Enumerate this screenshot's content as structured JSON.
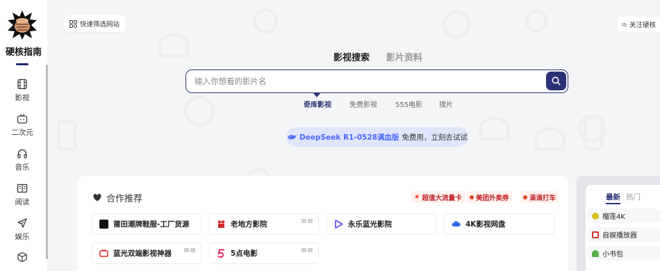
{
  "sidebar": {
    "brand": "硬核指南",
    "items": [
      {
        "label": "影视",
        "icon": "film-icon"
      },
      {
        "label": "二次元",
        "icon": "tv-icon"
      },
      {
        "label": "音乐",
        "icon": "headphones-icon"
      },
      {
        "label": "阅读",
        "icon": "book-icon"
      },
      {
        "label": "娱乐",
        "icon": "send-icon"
      },
      {
        "label": "",
        "icon": "cube-icon"
      }
    ]
  },
  "header": {
    "quick_filter_label": "快速筛选网站",
    "follow_label": "关注硬核"
  },
  "search": {
    "tabs": [
      "影视搜索",
      "影片资料"
    ],
    "active_tab": "影视搜索",
    "placeholder": "输入你想看的影片名",
    "value": "",
    "engines": [
      "奇库影视",
      "免费影视",
      "555电影",
      "搜片"
    ],
    "active_engine": "奇库影视"
  },
  "deepseek": {
    "highlight": "DeepSeek R1-0528满血版",
    "text": "免费用，立刻去试试"
  },
  "partners": {
    "title": "合作推荐",
    "promos": [
      "超值大流量卡",
      "美团外卖券",
      "滴滴打车"
    ],
    "items": [
      {
        "label": "莆田潮牌鞋服-工厂货源",
        "icon": "shoe-brand-icon"
      },
      {
        "label": "老地方影院",
        "icon": "camera-icon"
      },
      {
        "label": "永乐蓝光影院",
        "icon": "play-icon"
      },
      {
        "label": "4K影视网盘",
        "icon": "cloud-icon"
      },
      {
        "label": "蓝光双端影视神器",
        "icon": "tv-red-icon"
      },
      {
        "label": "5点电影",
        "icon": "five-icon"
      }
    ]
  },
  "hot_panel": {
    "tabs": [
      "最新",
      "热门"
    ],
    "active_tab": "最新",
    "items": [
      {
        "label": "榴莲4K",
        "color": "#d7c21c"
      },
      {
        "label": "自娱播放器",
        "color": "#d9322e"
      },
      {
        "label": "小书包",
        "color": "#5ab04a"
      }
    ]
  },
  "colors": {
    "accent": "#2b3177",
    "deepseek": "#4d6bfe",
    "promo": "#c1272d"
  }
}
